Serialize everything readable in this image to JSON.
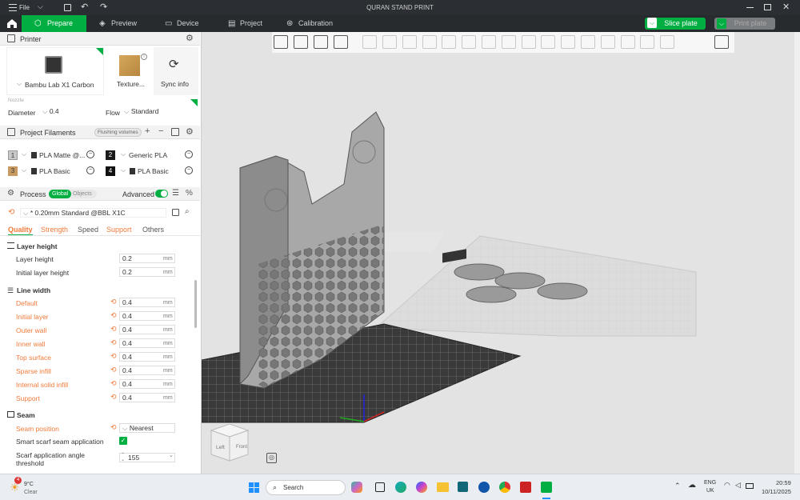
{
  "titlebar": {
    "file_label": "File",
    "title": "QURAN STAND PRINT"
  },
  "tabs": {
    "prepare": "Prepare",
    "preview": "Preview",
    "device": "Device",
    "project": "Project",
    "calibration": "Calibration"
  },
  "actions": {
    "slice": "Slice plate",
    "print": "Print plate"
  },
  "printer": {
    "header": "Printer",
    "name": "Bambu Lab X1 Carbon",
    "plate": "Texture...",
    "sync": "Sync info",
    "nozzle_label": "Nozzle",
    "diameter_label": "Diameter",
    "diameter_value": "0.4",
    "flow_label": "Flow",
    "flow_value": "Standard"
  },
  "filaments": {
    "header": "Project Filaments",
    "flushing": "Flushing volumes",
    "items": [
      {
        "num": "1",
        "name": "PLA Matte @...",
        "color": "#c8c8c8"
      },
      {
        "num": "2",
        "name": "Generic PLA",
        "color": "#1a1a1a"
      },
      {
        "num": "3",
        "name": "PLA Basic",
        "color": "#c79a63"
      },
      {
        "num": "4",
        "name": "PLA Basic",
        "color": "#111111"
      }
    ]
  },
  "process": {
    "header": "Process",
    "global": "Global",
    "objects": "Objects",
    "advanced": "Advanced",
    "preset": "* 0.20mm Standard @BBL X1C",
    "tabs": [
      "Quality",
      "Strength",
      "Speed",
      "Support",
      "Others"
    ]
  },
  "quality": {
    "layer_height": {
      "title": "Layer height",
      "rows": [
        {
          "label": "Layer height",
          "value": "0.2",
          "unit": "mm",
          "modified": false
        },
        {
          "label": "Initial layer height",
          "value": "0.2",
          "unit": "mm",
          "modified": false
        }
      ]
    },
    "line_width": {
      "title": "Line width",
      "rows": [
        {
          "label": "Default",
          "value": "0.4",
          "unit": "mm",
          "modified": true
        },
        {
          "label": "Initial layer",
          "value": "0.4",
          "unit": "mm",
          "modified": true
        },
        {
          "label": "Outer wall",
          "value": "0.4",
          "unit": "mm",
          "modified": true
        },
        {
          "label": "Inner wall",
          "value": "0.4",
          "unit": "mm",
          "modified": true
        },
        {
          "label": "Top surface",
          "value": "0.4",
          "unit": "mm",
          "modified": true
        },
        {
          "label": "Sparse infill",
          "value": "0.4",
          "unit": "mm",
          "modified": true
        },
        {
          "label": "Internal solid infill",
          "value": "0.4",
          "unit": "mm",
          "modified": true
        },
        {
          "label": "Support",
          "value": "0.4",
          "unit": "mm",
          "modified": true
        }
      ]
    },
    "seam": {
      "title": "Seam",
      "position_label": "Seam position",
      "position_value": "Nearest",
      "scarf_label": "Smart scarf seam application",
      "angle_label_1": "Scarf application angle",
      "angle_label_2": "threshold",
      "angle_value": "155"
    }
  },
  "viewcube": {
    "left": "Left",
    "front": "Front"
  },
  "taskbar": {
    "temp": "9°C",
    "weather": "Clear",
    "badge": "4",
    "search": "Search",
    "lang1": "ENG",
    "lang2": "UK",
    "time": "20:59",
    "date": "10/11/2025"
  },
  "colors": {
    "accent": "#00ae42",
    "modified": "#f07a3a",
    "titlebar": "#2b2f33"
  }
}
